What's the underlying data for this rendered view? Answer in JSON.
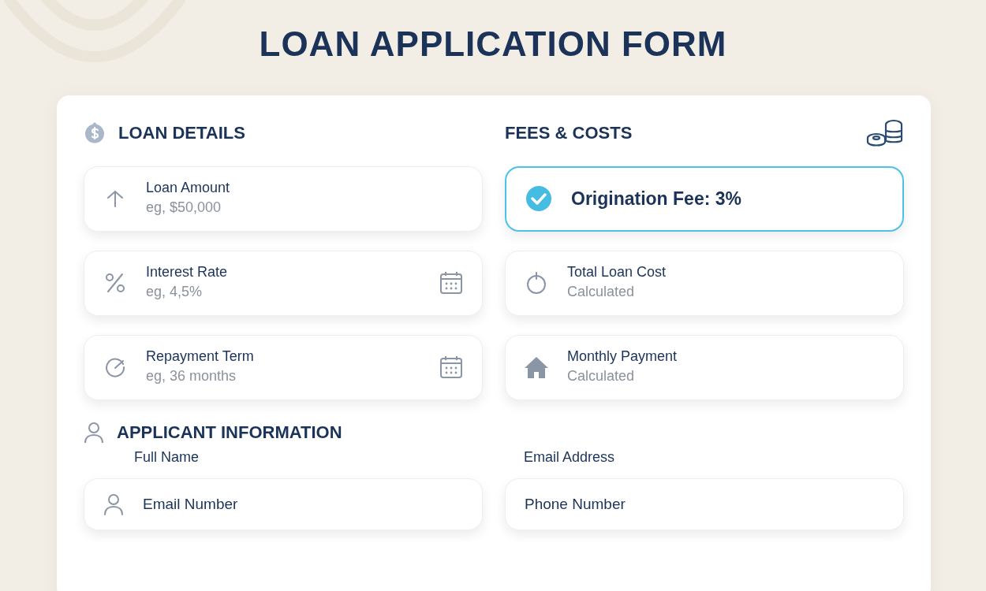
{
  "title": "LOAN APPLICATION FORM",
  "loan_details": {
    "heading": "LOAN DETAILS",
    "fields": [
      {
        "kind": "arrow",
        "label": "Loan Amount",
        "placeholder": "eg, $50,000",
        "calendar": false
      },
      {
        "kind": "percent",
        "label": "Interest Rate",
        "placeholder": "eg, 4,5%",
        "calendar": true
      },
      {
        "kind": "gauge",
        "label": "Repayment Term",
        "placeholder": "eg, 36 months",
        "calendar": true
      }
    ]
  },
  "fees_costs": {
    "heading": "FEES & COSTS",
    "fee": {
      "text": "Origination Fee: 3%",
      "checked": true
    },
    "fields": [
      {
        "kind": "timer",
        "label": "Total Loan Cost",
        "placeholder": "Calculated"
      },
      {
        "kind": "house",
        "label": "Monthly Payment",
        "placeholder": "Calculated"
      }
    ]
  },
  "applicant": {
    "heading": "APPLICANT INFORMATION",
    "fields": [
      {
        "kind": "person",
        "label": "Full Name",
        "value": "Email Number"
      },
      {
        "kind": "none",
        "label": "Email Address",
        "value": "Phone Number"
      }
    ]
  }
}
